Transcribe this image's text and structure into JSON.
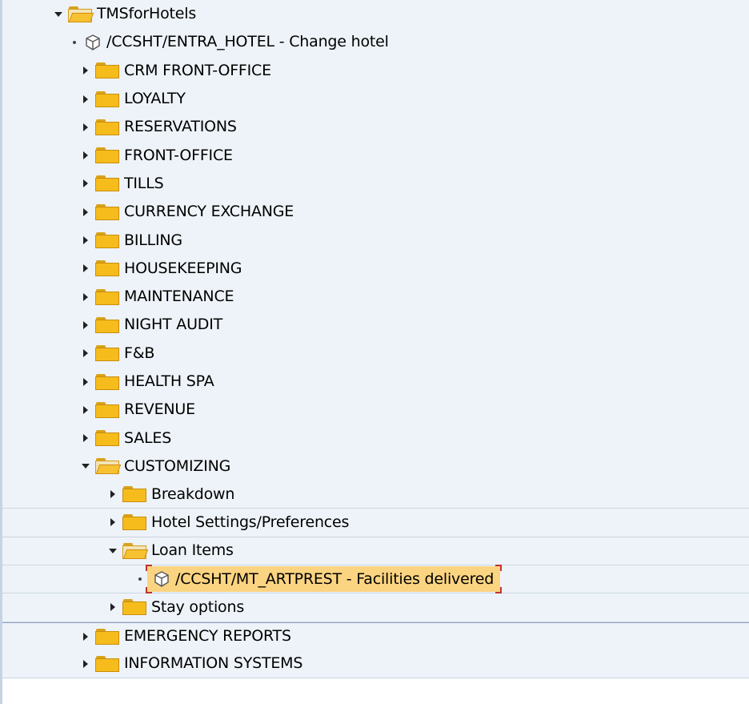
{
  "tree": {
    "root": {
      "label": "TMSforHotels"
    },
    "rows": [
      {
        "label": "/CCSHT/ENTRA_HOTEL - Change hotel"
      },
      {
        "label": "CRM FRONT-OFFICE"
      },
      {
        "label": "LOYALTY"
      },
      {
        "label": "RESERVATIONS"
      },
      {
        "label": "FRONT-OFFICE"
      },
      {
        "label": "TILLS"
      },
      {
        "label": "CURRENCY EXCHANGE"
      },
      {
        "label": "BILLING"
      },
      {
        "label": "HOUSEKEEPING"
      },
      {
        "label": "MAINTENANCE"
      },
      {
        "label": "NIGHT AUDIT"
      },
      {
        "label": "F&B"
      },
      {
        "label": "HEALTH SPA"
      },
      {
        "label": "REVENUE"
      },
      {
        "label": "SALES"
      },
      {
        "label": "CUSTOMIZING"
      },
      {
        "label": "Breakdown"
      },
      {
        "label": "Hotel Settings/Preferences"
      },
      {
        "label": "Loan Items"
      },
      {
        "label": "/CCSHT/MT_ARTPREST - Facilities delivered"
      },
      {
        "label": "Stay options"
      },
      {
        "label": "EMERGENCY REPORTS"
      },
      {
        "label": "INFORMATION SYSTEMS"
      }
    ]
  },
  "colors": {
    "selection": "#fbd481",
    "selection_corners": "#c0332e",
    "folder": "#f5bc1c",
    "row_background": "#eef3f9"
  }
}
